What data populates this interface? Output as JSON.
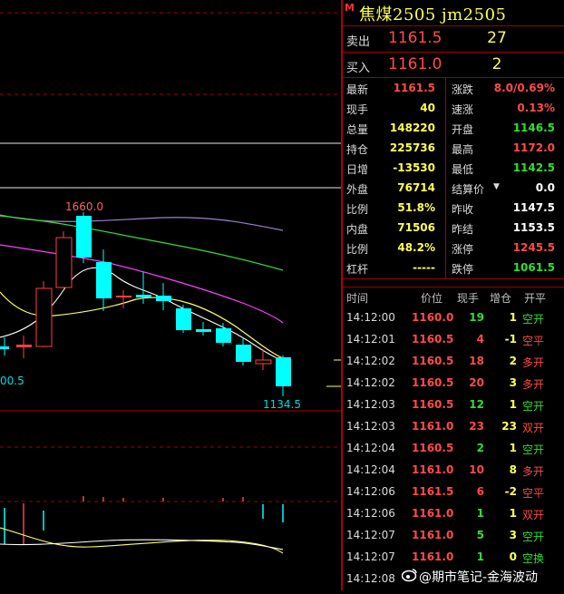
{
  "header": {
    "badge": "M",
    "title": "焦煤2505  jm2505"
  },
  "orderbook": {
    "ask": {
      "label": "卖出",
      "price": "1161.5",
      "volume": "27"
    },
    "bid": {
      "label": "买入",
      "price": "1161.0",
      "volume": "2"
    }
  },
  "quote": {
    "rows": [
      {
        "l": "最新",
        "lv": "1161.5",
        "lc": "red",
        "r": "涨跌",
        "rv": "8.0/0.69%",
        "rc": "red"
      },
      {
        "l": "现手",
        "lv": "40",
        "lc": "yellow",
        "r": "速涨",
        "rv": "0.13%",
        "rc": "red"
      },
      {
        "l": "总量",
        "lv": "148220",
        "lc": "yellow",
        "r": "开盘",
        "rv": "1146.5",
        "rc": "green"
      },
      {
        "l": "持仓",
        "lv": "225736",
        "lc": "yellow",
        "r": "最高",
        "rv": "1172.0",
        "rc": "red"
      },
      {
        "l": "日增",
        "lv": "-13530",
        "lc": "yellow",
        "r": "最低",
        "rv": "1142.5",
        "rc": "green"
      },
      {
        "l": "外盘",
        "lv": "76714",
        "lc": "yellow",
        "r": "结算价",
        "rv": "0.0",
        "rc": "white"
      },
      {
        "l": "比例",
        "lv": "51.8%",
        "lc": "yellow",
        "r": "昨收",
        "rv": "1147.5",
        "rc": "white"
      },
      {
        "l": "内盘",
        "lv": "71506",
        "lc": "yellow",
        "r": "昨结",
        "rv": "1153.5",
        "rc": "white"
      },
      {
        "l": "比例",
        "lv": "48.2%",
        "lc": "yellow",
        "r": "涨停",
        "rv": "1245.5",
        "rc": "red"
      },
      {
        "l": "杠杆",
        "lv": "-----",
        "lc": "yellow",
        "r": "跌停",
        "rv": "1061.5",
        "rc": "green"
      }
    ]
  },
  "trades": {
    "headers": {
      "time": "时间",
      "price": "价位",
      "volume": "现手",
      "oi": "增仓",
      "type": "开平"
    },
    "rows": [
      {
        "time": "14:12:00",
        "price": "1160.0",
        "vol": "19",
        "vc": "green",
        "oi": "1",
        "type": "空开",
        "tc": "green"
      },
      {
        "time": "14:12:01",
        "price": "1160.5",
        "vol": "4",
        "vc": "red",
        "oi": "-1",
        "type": "空平",
        "tc": "red"
      },
      {
        "time": "14:12:02",
        "price": "1160.5",
        "vol": "18",
        "vc": "red",
        "oi": "2",
        "type": "多开",
        "tc": "red"
      },
      {
        "time": "14:12:02",
        "price": "1160.5",
        "vol": "20",
        "vc": "red",
        "oi": "3",
        "type": "多开",
        "tc": "red"
      },
      {
        "time": "14:12:03",
        "price": "1160.5",
        "vol": "12",
        "vc": "green",
        "oi": "1",
        "type": "空开",
        "tc": "green"
      },
      {
        "time": "14:12:03",
        "price": "1161.0",
        "vol": "23",
        "vc": "red",
        "oi": "23",
        "type": "双开",
        "tc": "red"
      },
      {
        "time": "14:12:04",
        "price": "1160.5",
        "vol": "2",
        "vc": "green",
        "oi": "1",
        "type": "空开",
        "tc": "green"
      },
      {
        "time": "14:12:04",
        "price": "1161.0",
        "vol": "10",
        "vc": "red",
        "oi": "8",
        "type": "多开",
        "tc": "red"
      },
      {
        "time": "14:12:06",
        "price": "1161.5",
        "vol": "6",
        "vc": "red",
        "oi": "-2",
        "type": "空平",
        "tc": "red"
      },
      {
        "time": "14:12:06",
        "price": "1161.0",
        "vol": "1",
        "vc": "green",
        "oi": "1",
        "type": "双开",
        "tc": "red"
      },
      {
        "time": "14:12:07",
        "price": "1161.0",
        "vol": "5",
        "vc": "green",
        "oi": "3",
        "type": "空开",
        "tc": "green"
      },
      {
        "time": "14:12:07",
        "price": "1161.0",
        "vol": "1",
        "vc": "green",
        "oi": "0",
        "type": "空换",
        "tc": "green"
      },
      {
        "time": "14:12:08",
        "price": "",
        "vol": "",
        "vc": "green",
        "oi": "",
        "type": "",
        "tc": "green"
      }
    ]
  },
  "chart": {
    "labels": {
      "high": "1660.0",
      "low": "1134.5",
      "left": "00.5"
    },
    "colors": {
      "up": "#ff4040",
      "down": "#00ffff",
      "ma1": "#ffffff",
      "ma2": "#ffff55",
      "ma3": "#ff40ff",
      "ma4": "#33dd33",
      "ma5": "#b080ff"
    }
  },
  "watermark": {
    "text": "@期市笔记-金海波动",
    "icon": "weibo-icon"
  }
}
